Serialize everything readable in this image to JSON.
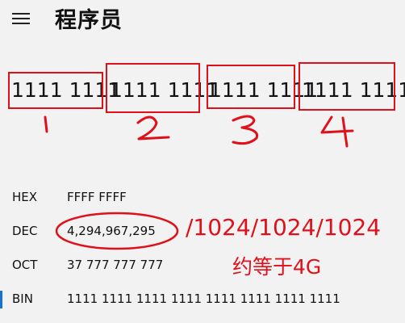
{
  "app": {
    "menu_icon": "hamburger-icon",
    "title": "程序员"
  },
  "bit_groups": [
    {
      "bits": "1111 1111",
      "mark": "1"
    },
    {
      "bits": "1111 1111",
      "mark": "2"
    },
    {
      "bits": "1111 1111",
      "mark": "3"
    },
    {
      "bits": "1111 1111",
      "mark": "4"
    }
  ],
  "radix": {
    "hex": {
      "label": "HEX",
      "value": "FFFF FFFF"
    },
    "dec": {
      "label": "DEC",
      "value": "4,294,967,295"
    },
    "oct": {
      "label": "OCT",
      "value": "37 777 777 777"
    },
    "bin": {
      "label": "BIN",
      "value": "1111 1111 1111 1111 1111 1111 1111 1111"
    }
  },
  "annotations": {
    "formula": "/1024/1024/1024",
    "approx": "约等于4G",
    "color": "#e0101a"
  },
  "colors": {
    "background": "#f2f2f2",
    "accent": "#1a6fd4",
    "annotation_red": "#e0101a"
  }
}
